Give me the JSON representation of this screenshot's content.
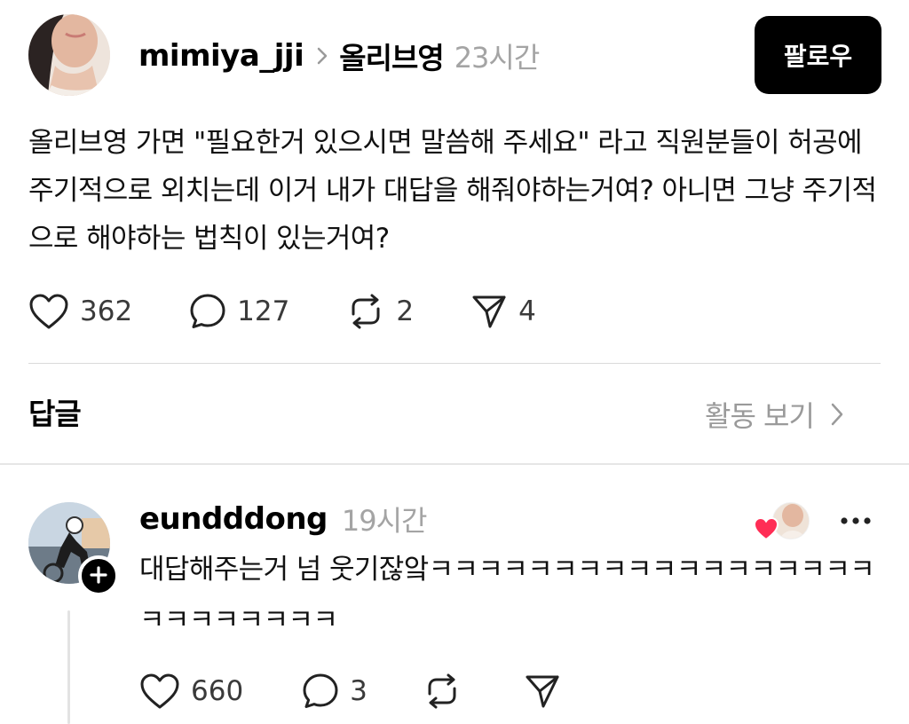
{
  "post": {
    "username": "mimiya_jji",
    "brand_tag": "올리브영",
    "time": "23시간",
    "follow_label": "팔로우",
    "body": "올리브영 가면 \"필요한거 있으시면 말씀해 주세요\" 라고 직원분들이 허공에 주기적으로 외치는데 이거 내가 대답을 해줘야하는거여? 아니면 그냥 주기적으로 해야하는 법칙이 있는거여?",
    "likes": "362",
    "comments": "127",
    "reposts": "2",
    "shares": "4"
  },
  "replies_section": {
    "label": "답글",
    "activity_link": "활동 보기"
  },
  "reply": {
    "username": "eundddong",
    "time": "19시간",
    "body": "대답해주는거 넘 웃기잖앜ㅋㅋㅋㅋㅋㅋㅋㅋㅋㅋㅋㅋㅋㅋㅋㅋㅋㅋㅋㅋㅋㅋㅋㅋㅋㅋ",
    "likes": "660",
    "comments": "3"
  },
  "colors": {
    "primary_text": "#000000",
    "muted_text": "#a4a4a4",
    "follow_button_bg": "#000000",
    "follow_button_text": "#ffffff",
    "like_heart": "#ff2d55",
    "divider": "#dadada"
  },
  "icons": {
    "like": "heart-outline-icon",
    "comment": "speech-bubble-icon",
    "repost": "repost-arrows-icon",
    "share": "paper-plane-icon",
    "chevron": "chevron-right-icon",
    "more": "ellipsis-horizontal-icon",
    "follow_badge": "plus-icon",
    "liked_indicator": "heart-filled-icon"
  }
}
